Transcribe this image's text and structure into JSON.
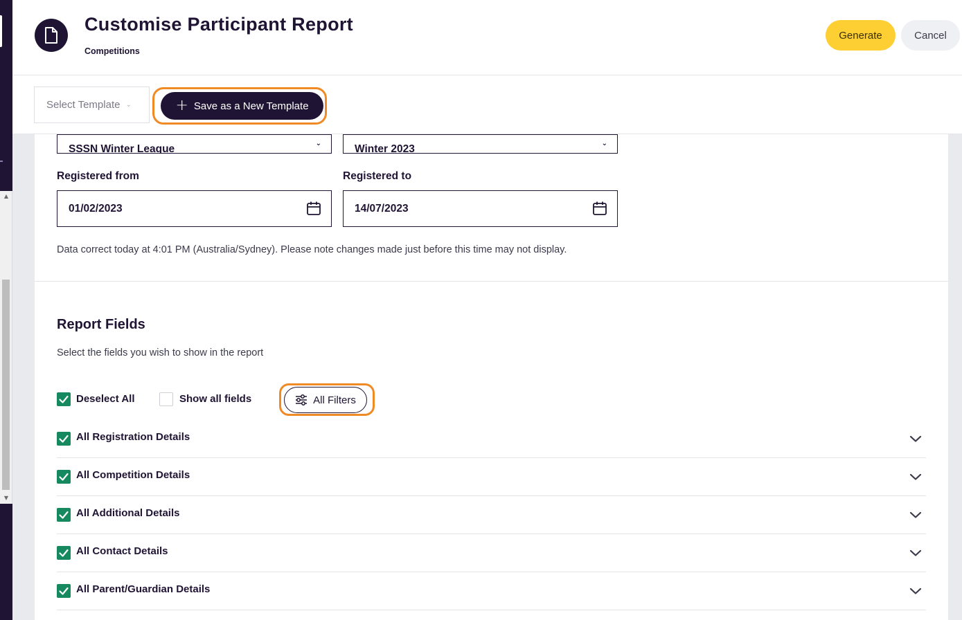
{
  "header": {
    "title": "Customise Participant Report",
    "subtitle": "Competitions",
    "generate_label": "Generate",
    "cancel_label": "Cancel"
  },
  "template_bar": {
    "select_placeholder": "Select Template",
    "save_label": "Save as a New Template"
  },
  "filters": {
    "competition_value": "SSSN Winter League",
    "season_value": "Winter 2023",
    "registered_from_label": "Registered from",
    "registered_from_value": "01/02/2023",
    "registered_to_label": "Registered to",
    "registered_to_value": "14/07/2023",
    "note": "Data correct today at 4:01 PM (Australia/Sydney). Please note changes made just before this time may not display."
  },
  "report_fields": {
    "title": "Report Fields",
    "description": "Select the fields you wish to show in the report",
    "deselect_all_label": "Deselect All",
    "deselect_all_checked": true,
    "show_all_fields_label": "Show all fields",
    "show_all_fields_checked": false,
    "all_filters_label": "All Filters",
    "sections": [
      {
        "label": "All Registration Details",
        "checked": true
      },
      {
        "label": "All Competition Details",
        "checked": true
      },
      {
        "label": "All Additional Details",
        "checked": true
      },
      {
        "label": "All Contact Details",
        "checked": true
      },
      {
        "label": "All Parent/Guardian Details",
        "checked": true
      }
    ]
  },
  "colors": {
    "primary": "#1f1433",
    "accent_yellow": "#fdcf33",
    "checkbox_green": "#168a5e",
    "highlight_orange": "#f08a24"
  },
  "icons": {
    "header": "document-icon",
    "calendar": "calendar-icon",
    "filter": "sliders-icon",
    "accordion": "chevron-down-icon"
  }
}
